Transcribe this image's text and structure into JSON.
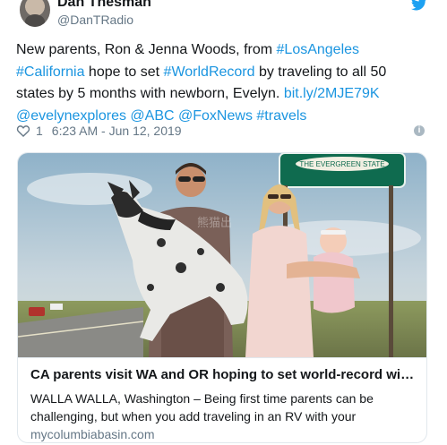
{
  "author": {
    "display_name": "Dan Thesman",
    "handle": "@DanTRadio"
  },
  "tweet": {
    "lines": [
      [
        {
          "text": "New parents, Ron & Jenna Woods, from ",
          "link": false
        },
        {
          "text": "#LosAngeles",
          "link": true
        }
      ],
      [
        {
          "text": "#California",
          "link": true
        },
        {
          "text": " hope to set ",
          "link": false
        },
        {
          "text": "#WorldRecord",
          "link": true
        },
        {
          "text": " by traveling to all 50",
          "link": false
        }
      ],
      [
        {
          "text": "states by 5 months with newborn, Evelyn. ",
          "link": false
        },
        {
          "text": "bit.ly/2MJE79K",
          "link": true
        }
      ],
      [
        {
          "text": "@evelynexplores",
          "link": true
        },
        {
          "text": " ",
          "link": false
        },
        {
          "text": "@ABC",
          "link": true
        },
        {
          "text": " ",
          "link": false
        },
        {
          "text": "@FoxNews",
          "link": true
        },
        {
          "text": " ",
          "link": false
        },
        {
          "text": "#travels",
          "link": true
        }
      ]
    ]
  },
  "meta": {
    "likes": "1",
    "timestamp": "6:23 AM - Jun 12, 2019"
  },
  "card": {
    "sign_text": "THE EVERGREEN STATE",
    "title": "CA parents visit WA and OR hoping to set world-record with ...",
    "description_lines": [
      "WALLA WALLA, Washington – Being first time parents can be",
      "challenging, but when you add traveling in an RV with your"
    ],
    "domain": "mycolumbiabasin.com"
  },
  "icons": {
    "brand": "twitter-bird-icon",
    "like": "heart-icon",
    "info": "info-icon"
  },
  "colors": {
    "link": "#1b95e0",
    "secondary_text": "#657786",
    "border": "#e1e8ed",
    "twitter_blue": "#1da1f2"
  }
}
